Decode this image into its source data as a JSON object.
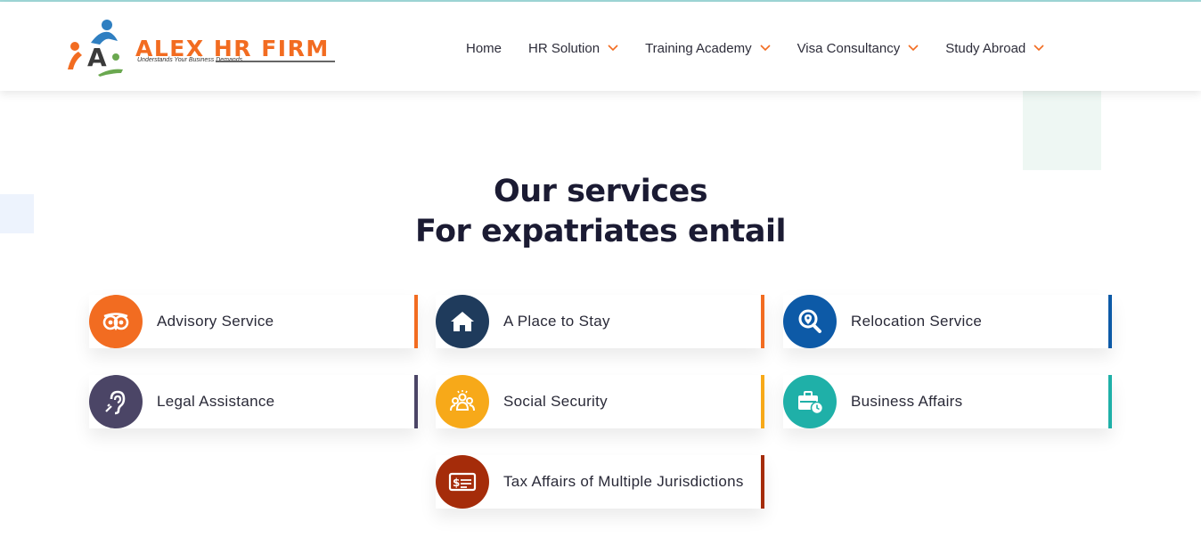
{
  "brand": {
    "name": "ALEX HR FIRM",
    "tagline": "Understands Your Business Demands"
  },
  "nav": {
    "items": [
      {
        "label": "Home",
        "has_dropdown": false
      },
      {
        "label": "HR Solution",
        "has_dropdown": true
      },
      {
        "label": "Training Academy",
        "has_dropdown": true
      },
      {
        "label": "Visa Consultancy",
        "has_dropdown": true
      },
      {
        "label": "Study Abroad",
        "has_dropdown": true
      }
    ]
  },
  "section": {
    "title_line1": "Our services",
    "title_line2": "For expatriates entail"
  },
  "services": [
    {
      "label": "Advisory Service",
      "icon": "owl-icon",
      "color": "#f26c21"
    },
    {
      "label": "A Place to Stay",
      "icon": "home-icon",
      "color": "#1f3b5c"
    },
    {
      "label": "Relocation Service",
      "icon": "location-search-icon",
      "color": "#0d5aa7"
    },
    {
      "label": "Legal Assistance",
      "icon": "ear-icon",
      "color": "#4b4566"
    },
    {
      "label": "Social Security",
      "icon": "group-icon",
      "color": "#f7a919"
    },
    {
      "label": "Business Affairs",
      "icon": "briefcase-clock-icon",
      "color": "#1fb0a8"
    },
    {
      "label": "Tax Affairs of Multiple Jurisdictions",
      "icon": "money-card-icon",
      "color": "#a52c0a"
    }
  ],
  "colors": {
    "brand_orange": "#f26c21",
    "heading": "#1b1b33",
    "mint_deco": "#eef7f3",
    "blue_deco": "#edf3fd"
  }
}
